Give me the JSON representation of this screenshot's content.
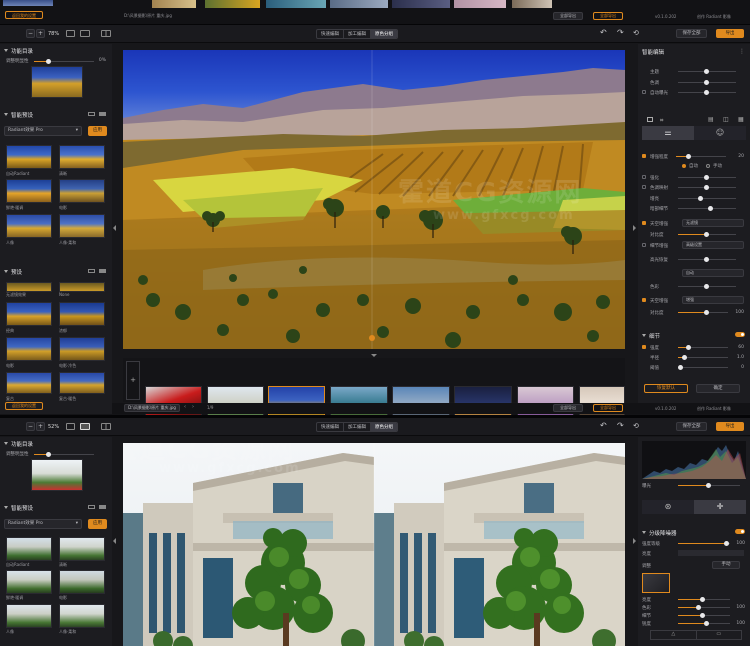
{
  "top_strip": {
    "left_button": "返回我的设置",
    "center_path": "D:\\风景摄影\\原片 重庆.jpg",
    "right_button_1": "全部导出",
    "right_button_2": "全部导出",
    "version": "v0.1.0.202",
    "brand": "创作 Radiant 影像"
  },
  "top_app": {
    "zoom": "78%",
    "modes": [
      "快速编辑",
      "加工编辑",
      "原色分组"
    ],
    "active_mode": 2,
    "save_button": "保存全部",
    "export_button": "导出",
    "left_panel": {
      "section_functions": "功能目录",
      "auto_label": "调整明显性",
      "auto_value": "0%",
      "section_presets": "智能预设",
      "preset_select": "Radiant效果 Pro",
      "apply_button": "应用",
      "preset_thumbs": [
        "自动Radiant",
        "清晰",
        "鲜艳·暖调",
        "电影",
        "人像",
        "人像·柔和"
      ],
      "section_lut": "预设",
      "lut_thumbs": [
        "无滤镜效果",
        "None",
        "经典",
        "浓郁",
        "电影",
        "电影·冷色",
        "复古",
        "复古·暖色"
      ],
      "footer_button": "返回我的设置"
    },
    "right_panel": {
      "title": "智能编辑",
      "rows_top": [
        {
          "label": "主题",
          "value": ""
        },
        {
          "label": "色调",
          "value": ""
        },
        {
          "label": "自动曝光",
          "value": ""
        }
      ],
      "intensity_label": "增强程度",
      "intensity_value": "20",
      "radio_1": "自动",
      "radio_2": "手动",
      "rows_mid": [
        "强化",
        "色调映射",
        "增亮",
        "暗部细节",
        "高光恢复",
        "色彩",
        "天空增强",
        "对比度",
        "细节增强"
      ],
      "dropdown_1": "无滤镜",
      "dropdown_2": "高级设置",
      "dropdown_3": "自动",
      "dropdown_4": "增强",
      "section_detail": "细节",
      "detail_rows": [
        {
          "label": "强度",
          "value": "60"
        },
        {
          "label": "半径",
          "value": "1.0"
        },
        {
          "label": "阈值",
          "value": "0"
        }
      ],
      "reset_button": "恢复默认",
      "ok_button": "确定",
      "intensity_100": "100"
    },
    "filmstrip_count": "1/9",
    "statusbar_path": "D:\\风景摄影\\原片 重庆.jpg",
    "statusbar_right_1": "全部导出",
    "statusbar_right_2": "全部导出",
    "version": "v0.1.0.202",
    "brand": "创作 Radiant 影像"
  },
  "bottom_app": {
    "zoom": "52%",
    "modes": [
      "快速编辑",
      "加工编辑",
      "原色分组"
    ],
    "active_mode": 2,
    "save_button": "保存全部",
    "export_button": "导出",
    "left_panel": {
      "section_functions": "功能目录",
      "auto_label": "调整明显性",
      "section_presets": "智能预设",
      "preset_select": "Radiant效果 Pro",
      "apply_button": "应用",
      "preset_thumbs": [
        "自动Radiant",
        "清晰",
        "鲜艳·暖调",
        "电影",
        "人像",
        "人像·柔和"
      ]
    },
    "right_panel": {
      "histogram_label": "直方图",
      "exposure_label": "曝光",
      "section_title": "分级降噪器",
      "rows": [
        "强度等级",
        "亮度",
        "色彩",
        "细节"
      ],
      "mode_label": "调整",
      "mode_button": "手动",
      "mini_rows": [
        {
          "label": "亮度",
          "value": "0"
        },
        {
          "label": "色彩",
          "value": "100"
        },
        {
          "label": "细节",
          "value": "0"
        },
        {
          "label": "锐度",
          "value": "100"
        }
      ],
      "hundred": "100"
    }
  },
  "watermarks": [
    "霍道CG资源网",
    "www.gfxcg.com",
    "霍道CG资源网",
    "www.gfxcg.com"
  ],
  "colors": {
    "accent": "#e08a1e",
    "bg": "#141417",
    "panel": "#1c1c20"
  }
}
